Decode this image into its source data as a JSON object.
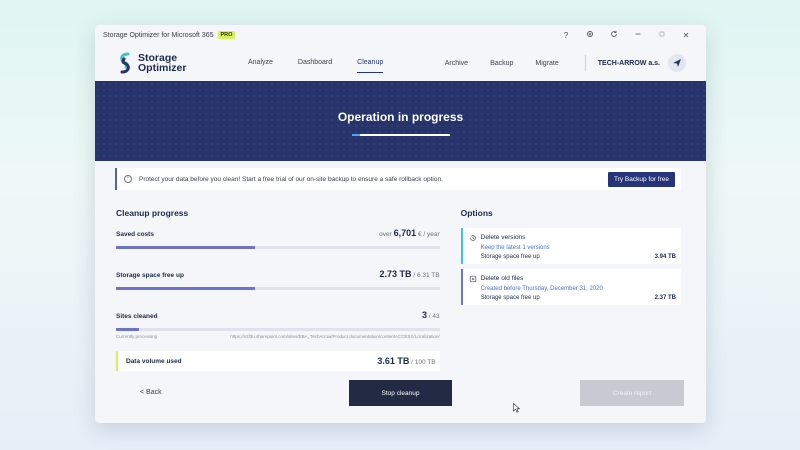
{
  "window": {
    "title": "Storage Optimizer for Microsoft 365",
    "badge": "PRO",
    "icons": [
      "help-icon",
      "settings-icon",
      "refresh-icon",
      "minimize-icon",
      "maximize-icon",
      "close-icon"
    ],
    "help_glyph": "?",
    "close_glyph": "✕"
  },
  "nav": {
    "logo_line1": "Storage",
    "logo_line2": "Optimizer",
    "links": [
      "Analyze",
      "Dashboard",
      "Cleanup"
    ],
    "active": "Cleanup",
    "right_links": [
      "Archive",
      "Backup",
      "Migrate"
    ],
    "company": "TECH-ARROW a.s."
  },
  "banner": {
    "title": "Operation in progress",
    "progress": 0.1
  },
  "notice": {
    "text": "Protect your data before you clean! Start a free trial of our on-site backup to ensure a safe rollback option.",
    "button": "Try Backup for free"
  },
  "cleanup": {
    "title": "Cleanup progress",
    "saved_costs": {
      "label": "Saved costs",
      "prefix": "over",
      "value": "6,701",
      "unit": "€ / year",
      "progress": 0.43
    },
    "storage": {
      "label": "Storage space free up",
      "value": "2.73 TB",
      "total": "/ 6.31 TB",
      "progress": 0.43
    },
    "sites": {
      "label": "Sites cleaned",
      "value": "3",
      "total": "/ 43",
      "progress": 0.07,
      "processing_label": "Currently processing",
      "processing_url": "https://x2f3u.sharepoint.com/sites/EBA_TechArrow/Product documentation/contentACCESS/Localization/"
    },
    "volume": {
      "label": "Data volume used",
      "value": "3.61 TB",
      "total": "/ 100 TB"
    }
  },
  "options": {
    "title": "Options",
    "items": [
      {
        "title": "Delete versions",
        "sub": "Keep the latest 1 versions",
        "row_label": "Storage space free up",
        "row_value": "3.94 TB"
      },
      {
        "title": "Delete old files",
        "sub": "Created before Thursday, December 31, 2020",
        "row_label": "Storage space free up",
        "row_value": "2.37 TB"
      }
    ]
  },
  "footer": {
    "back": "< Back",
    "stop": "Stop cleanup",
    "report": "Create report"
  },
  "colors": {
    "brand_navy": "#26346b",
    "accent_purple": "#6f73c4",
    "accent_teal": "#3bc6cf",
    "accent_lime": "#d6f15a"
  }
}
